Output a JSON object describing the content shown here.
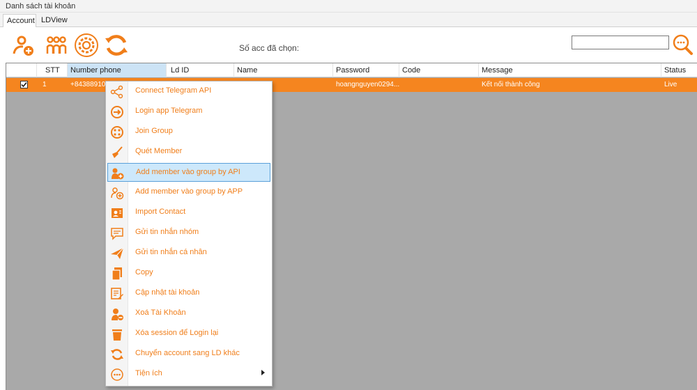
{
  "window": {
    "title": "Danh sách tài khoản"
  },
  "tabs": [
    {
      "label": "Account",
      "active": true
    },
    {
      "label": "LDView",
      "active": false
    }
  ],
  "toolbar": {
    "buttons": [
      {
        "name": "add-account",
        "icon": "user-add-icon"
      },
      {
        "name": "group",
        "icon": "users-group-icon"
      },
      {
        "name": "settings",
        "icon": "gear-icon"
      },
      {
        "name": "refresh",
        "icon": "refresh-icon"
      }
    ],
    "selected_label": "Số acc đã chọn:",
    "search": {
      "value": "",
      "placeholder": ""
    }
  },
  "table": {
    "columns": [
      "",
      "STT",
      "Number phone",
      "Ld ID",
      "Name",
      "Password",
      "Code",
      "Message",
      "Status"
    ],
    "sorted_column": "Number phone",
    "rows": [
      {
        "checked": true,
        "stt": "1",
        "phone": "+84388910",
        "ld_id": "",
        "name": "",
        "password": "hoangnguyen0294...",
        "code": "",
        "message": "Kết nối thành công",
        "status": "Live"
      }
    ]
  },
  "context_menu": {
    "items": [
      {
        "label": "Connect Telegram API",
        "icon": "share-nodes-icon"
      },
      {
        "label": "Login app Telegram",
        "icon": "login-arrow-icon"
      },
      {
        "label": "Join Group",
        "icon": "join-group-icon"
      },
      {
        "label": "Quét Member",
        "icon": "broom-icon"
      },
      {
        "label": "Add member vào group by API",
        "icon": "users-add-icon",
        "hover": true
      },
      {
        "label": "Add member vào group by APP",
        "icon": "users-app-icon"
      },
      {
        "label": "Import Contact",
        "icon": "contact-card-icon"
      },
      {
        "label": "Gửi tin nhắn nhóm",
        "icon": "chat-bubble-icon"
      },
      {
        "label": "Gửi tin nhắn cá nhân",
        "icon": "paper-plane-icon"
      },
      {
        "label": "Copy",
        "icon": "copy-icon"
      },
      {
        "label": "Cập nhật tài khoản",
        "icon": "edit-account-icon"
      },
      {
        "label": "Xoá Tài Khoản",
        "icon": "delete-user-icon"
      },
      {
        "label": "Xóa session để Login lại",
        "icon": "trash-icon"
      },
      {
        "label": "Chuyển account sang LD khác",
        "icon": "swap-icon"
      },
      {
        "label": "Tiện ích",
        "icon": "more-dots-icon",
        "submenu": true
      }
    ]
  },
  "colors": {
    "accent": "#f5851f",
    "menu_text": "#f07e1a",
    "grid_bg": "#a9a9a9",
    "hover_bg": "#cde8fb",
    "hover_border": "#5aa0d9"
  }
}
